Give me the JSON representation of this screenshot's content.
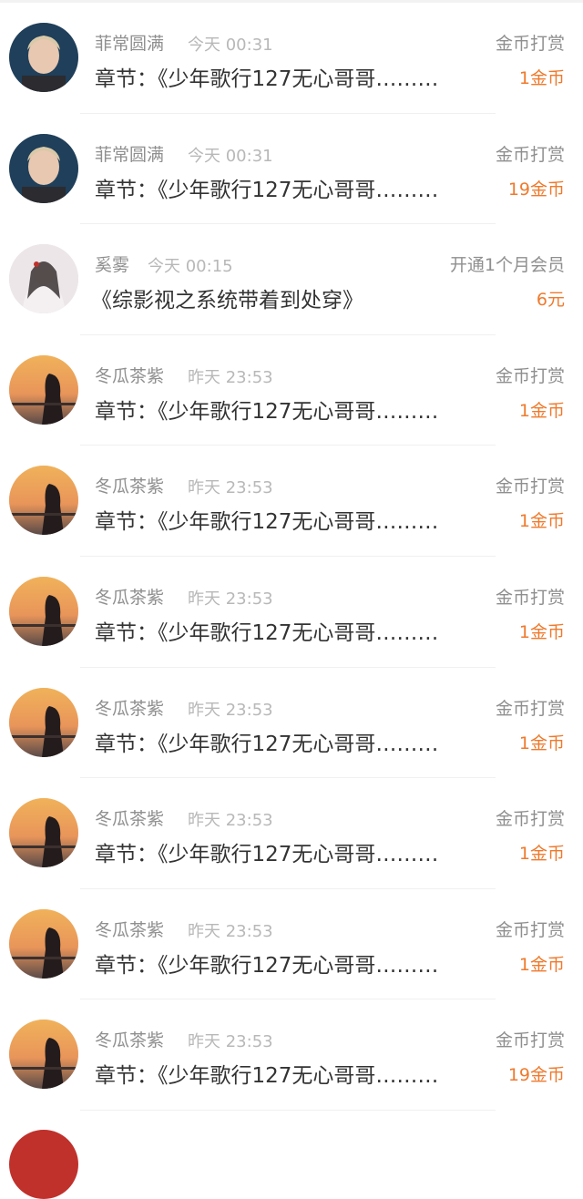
{
  "items": [
    {
      "name": "菲常圆满",
      "time": "今天 00:31",
      "type": "金币打赏",
      "desc": "章节：《少年歌行127无心哥哥………",
      "amount": "1金币",
      "avatar": "male-portrait-avatar"
    },
    {
      "name": "菲常圆满",
      "time": "今天 00:31",
      "type": "金币打赏",
      "desc": "章节：《少年歌行127无心哥哥………",
      "amount": "19金币",
      "avatar": "male-portrait-avatar"
    },
    {
      "name": "奚雾",
      "time": "今天 00:15",
      "type": "开通1个月会员",
      "desc": "《综影视之系统带着到处穿》",
      "amount": "6元",
      "avatar": "illustrated-woman-avatar"
    },
    {
      "name": "冬瓜茶紫",
      "time": "昨天 23:53",
      "type": "金币打赏",
      "desc": "章节：《少年歌行127无心哥哥………",
      "amount": "1金币",
      "avatar": "sunset-girl-avatar"
    },
    {
      "name": "冬瓜茶紫",
      "time": "昨天 23:53",
      "type": "金币打赏",
      "desc": "章节：《少年歌行127无心哥哥………",
      "amount": "1金币",
      "avatar": "sunset-girl-avatar"
    },
    {
      "name": "冬瓜茶紫",
      "time": "昨天 23:53",
      "type": "金币打赏",
      "desc": "章节：《少年歌行127无心哥哥………",
      "amount": "1金币",
      "avatar": "sunset-girl-avatar"
    },
    {
      "name": "冬瓜茶紫",
      "time": "昨天 23:53",
      "type": "金币打赏",
      "desc": "章节：《少年歌行127无心哥哥………",
      "amount": "1金币",
      "avatar": "sunset-girl-avatar"
    },
    {
      "name": "冬瓜茶紫",
      "time": "昨天 23:53",
      "type": "金币打赏",
      "desc": "章节：《少年歌行127无心哥哥………",
      "amount": "1金币",
      "avatar": "sunset-girl-avatar"
    },
    {
      "name": "冬瓜茶紫",
      "time": "昨天 23:53",
      "type": "金币打赏",
      "desc": "章节：《少年歌行127无心哥哥………",
      "amount": "1金币",
      "avatar": "sunset-girl-avatar"
    },
    {
      "name": "冬瓜茶紫",
      "time": "昨天 23:53",
      "type": "金币打赏",
      "desc": "章节：《少年歌行127无心哥哥………",
      "amount": "19金币",
      "avatar": "sunset-girl-avatar"
    }
  ],
  "colors": {
    "amount": "#ef7a2d",
    "name": "#8f8f8f",
    "time": "#b8b8b8",
    "desc": "#333333"
  }
}
